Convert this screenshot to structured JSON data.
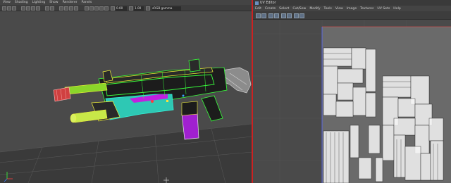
{
  "viewport": {
    "menu": [
      "View",
      "Shading",
      "Lighting",
      "Show",
      "Renderer",
      "Panels"
    ],
    "toolbar": {
      "exposure": "0.00",
      "gamma": "1.00",
      "colorspace": "sRGB gamma"
    },
    "icons": [
      "camera-icon",
      "grid-icon",
      "wireframe-icon",
      "smooth-shade-icon",
      "textured-icon",
      "lights-icon",
      "shadows-icon",
      "isolate-icon",
      "xray-icon",
      "resolution-gate-icon",
      "film-gate-icon",
      "safe-action-icon",
      "hud-icon"
    ]
  },
  "uv_editor": {
    "title": "UV Editor",
    "menu": [
      "Edit",
      "Create",
      "Select",
      "Cut/Sew",
      "Modify",
      "Tools",
      "View",
      "Image",
      "Textures",
      "UV Sets",
      "Help"
    ],
    "icons": [
      "shaded-uv-icon",
      "distortion-icon",
      "checker-icon",
      "dim-image-icon",
      "snap-icon",
      "grid-toggle-icon",
      "filter-icon",
      "image-display-icon"
    ]
  },
  "colors": {
    "viewport_bg": "#4a4a4a",
    "panel_bg": "#444444",
    "wire_green": "#39ff3c",
    "wire_yellow": "#f2f23a",
    "wire_cyan": "#34f0d8",
    "magenta": "#c020e0",
    "uv_outline": "#ffffff",
    "splitter": "#cc2222"
  }
}
